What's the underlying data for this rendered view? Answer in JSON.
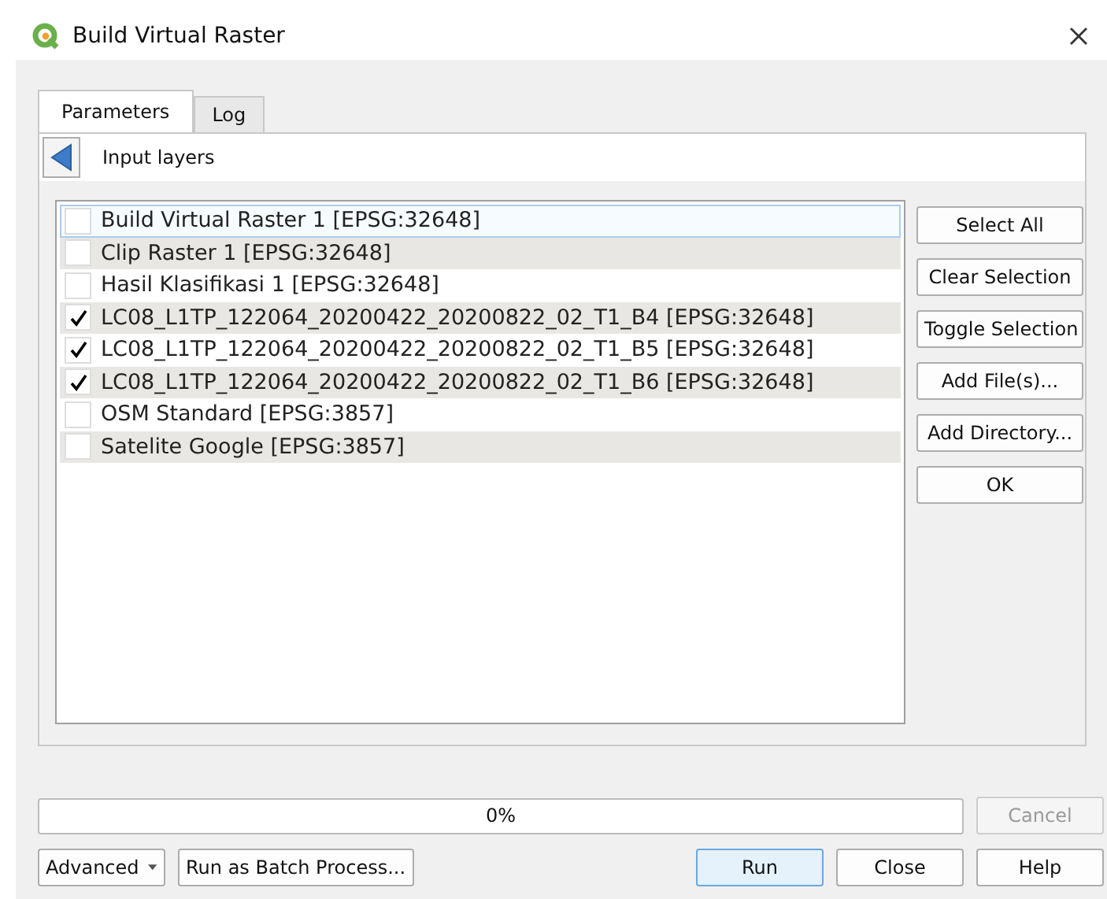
{
  "window": {
    "title": "Build Virtual Raster"
  },
  "tabs": [
    {
      "label": "Parameters",
      "selected": true
    },
    {
      "label": "Log",
      "selected": false
    }
  ],
  "panel": {
    "title": "Input layers"
  },
  "layers": [
    {
      "label": "Build Virtual Raster 1 [EPSG:32648]",
      "checked": false,
      "current": true
    },
    {
      "label": "Clip Raster 1 [EPSG:32648]",
      "checked": false,
      "current": false
    },
    {
      "label": "Hasil Klasifikasi 1 [EPSG:32648]",
      "checked": false,
      "current": false
    },
    {
      "label": "LC08_L1TP_122064_20200422_20200822_02_T1_B4 [EPSG:32648]",
      "checked": true,
      "current": false
    },
    {
      "label": "LC08_L1TP_122064_20200422_20200822_02_T1_B5 [EPSG:32648]",
      "checked": true,
      "current": false
    },
    {
      "label": "LC08_L1TP_122064_20200422_20200822_02_T1_B6 [EPSG:32648]",
      "checked": true,
      "current": false
    },
    {
      "label": "OSM Standard [EPSG:3857]",
      "checked": false,
      "current": false
    },
    {
      "label": "Satelite Google [EPSG:3857]",
      "checked": false,
      "current": false
    }
  ],
  "side_buttons": [
    "Select All",
    "Clear Selection",
    "Toggle Selection",
    "Add File(s)...",
    "Add Directory...",
    "OK"
  ],
  "progress": {
    "level": 0,
    "reading": "0%"
  },
  "cancel_button": {
    "label": "Cancel",
    "disabled": true
  },
  "advanced_button": {
    "label": "Advanced"
  },
  "batch_button": {
    "label": "Run as Batch Process..."
  },
  "footer_buttons": [
    {
      "label": "Run",
      "default": true
    },
    {
      "label": "Close",
      "default": false
    },
    {
      "label": "Help",
      "default": false
    }
  ]
}
